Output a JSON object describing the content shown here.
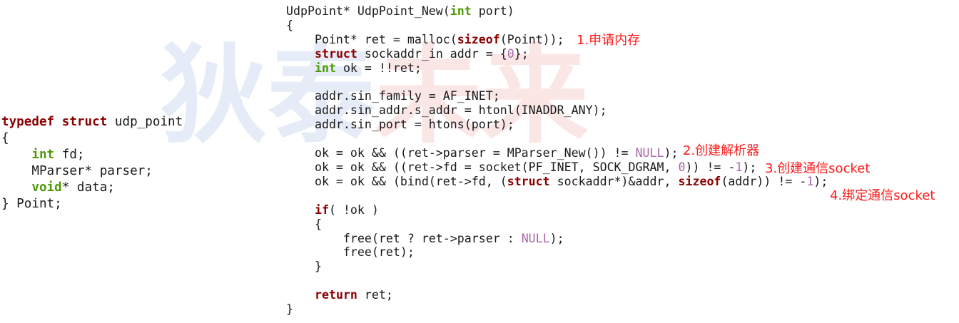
{
  "watermark": {
    "chars": [
      "狄",
      "泰",
      "未",
      "来"
    ],
    "colors": [
      "#e6ecf7",
      "#e6ecf7",
      "#fbe6e6",
      "#fbe6e6"
    ]
  },
  "colors": {
    "keyword": "#8b0000",
    "type": "#4e9a06",
    "number": "#a868a8",
    "annotation": "#ff1a1a",
    "text": "#1a1a1a"
  },
  "left_code": [
    [
      [
        "kw",
        "typedef"
      ],
      [
        "t",
        " "
      ],
      [
        "kw",
        "struct"
      ],
      [
        "t",
        " udp_point"
      ]
    ],
    [
      [
        "t",
        "{"
      ]
    ],
    [
      [
        "t",
        "    "
      ],
      [
        "ty",
        "int"
      ],
      [
        "t",
        " fd;"
      ]
    ],
    [
      [
        "t",
        "    MParser* parser;"
      ]
    ],
    [
      [
        "t",
        "    "
      ],
      [
        "ty",
        "void"
      ],
      [
        "t",
        "* data;"
      ]
    ],
    [
      [
        "t",
        "} Point;"
      ]
    ]
  ],
  "right_code": [
    [
      [
        "t",
        "UdpPoint* UdpPoint_New("
      ],
      [
        "ty",
        "int"
      ],
      [
        "t",
        " port)"
      ]
    ],
    [
      [
        "t",
        "{"
      ]
    ],
    [
      [
        "t",
        "    Point* ret = malloc("
      ],
      [
        "kw",
        "sizeof"
      ],
      [
        "t",
        "(Point));"
      ]
    ],
    [
      [
        "t",
        "    "
      ],
      [
        "kw",
        "struct"
      ],
      [
        "t",
        " sockaddr_in addr = {"
      ],
      [
        "num",
        "0"
      ],
      [
        "t",
        "};"
      ]
    ],
    [
      [
        "t",
        "    "
      ],
      [
        "ty",
        "int"
      ],
      [
        "t",
        " ok = !!ret;"
      ]
    ],
    [
      [
        "t",
        ""
      ]
    ],
    [
      [
        "t",
        "    addr.sin_family = AF_INET;"
      ]
    ],
    [
      [
        "t",
        "    addr.sin_addr.s_addr = htonl(INADDR_ANY);"
      ]
    ],
    [
      [
        "t",
        "    addr.sin_port = htons(port);"
      ]
    ],
    [
      [
        "t",
        ""
      ]
    ],
    [
      [
        "t",
        "    ok = ok && ((ret->parser = MParser_New()) != "
      ],
      [
        "num",
        "NULL"
      ],
      [
        "t",
        ");"
      ]
    ],
    [
      [
        "t",
        "    ok = ok && ((ret->fd = socket(PF_INET, SOCK_DGRAM, "
      ],
      [
        "num",
        "0"
      ],
      [
        "t",
        ")) != -"
      ],
      [
        "num",
        "1"
      ],
      [
        "t",
        ");"
      ]
    ],
    [
      [
        "t",
        "    ok = ok && (bind(ret->fd, ("
      ],
      [
        "kw",
        "struct"
      ],
      [
        "t",
        " sockaddr*)&addr, "
      ],
      [
        "kw",
        "sizeof"
      ],
      [
        "t",
        "(addr)) != -"
      ],
      [
        "num",
        "1"
      ],
      [
        "t",
        ");"
      ]
    ],
    [
      [
        "t",
        ""
      ]
    ],
    [
      [
        "t",
        "    "
      ],
      [
        "kw",
        "if"
      ],
      [
        "t",
        "( !ok )"
      ]
    ],
    [
      [
        "t",
        "    {"
      ]
    ],
    [
      [
        "t",
        "        free(ret ? ret->parser : "
      ],
      [
        "num",
        "NULL"
      ],
      [
        "t",
        ");"
      ]
    ],
    [
      [
        "t",
        "        free(ret);"
      ]
    ],
    [
      [
        "t",
        "    }"
      ]
    ],
    [
      [
        "t",
        ""
      ]
    ],
    [
      [
        "t",
        "    "
      ],
      [
        "kw",
        "return"
      ],
      [
        "t",
        " ret;"
      ]
    ],
    [
      [
        "t",
        "}"
      ]
    ]
  ],
  "annotations": [
    {
      "id": "note-1",
      "text": "1.申请内存"
    },
    {
      "id": "note-2",
      "text": "2.创建解析器"
    },
    {
      "id": "note-3",
      "text": "3.创建通信socket"
    },
    {
      "id": "note-4",
      "text": "4.绑定通信socket"
    }
  ]
}
